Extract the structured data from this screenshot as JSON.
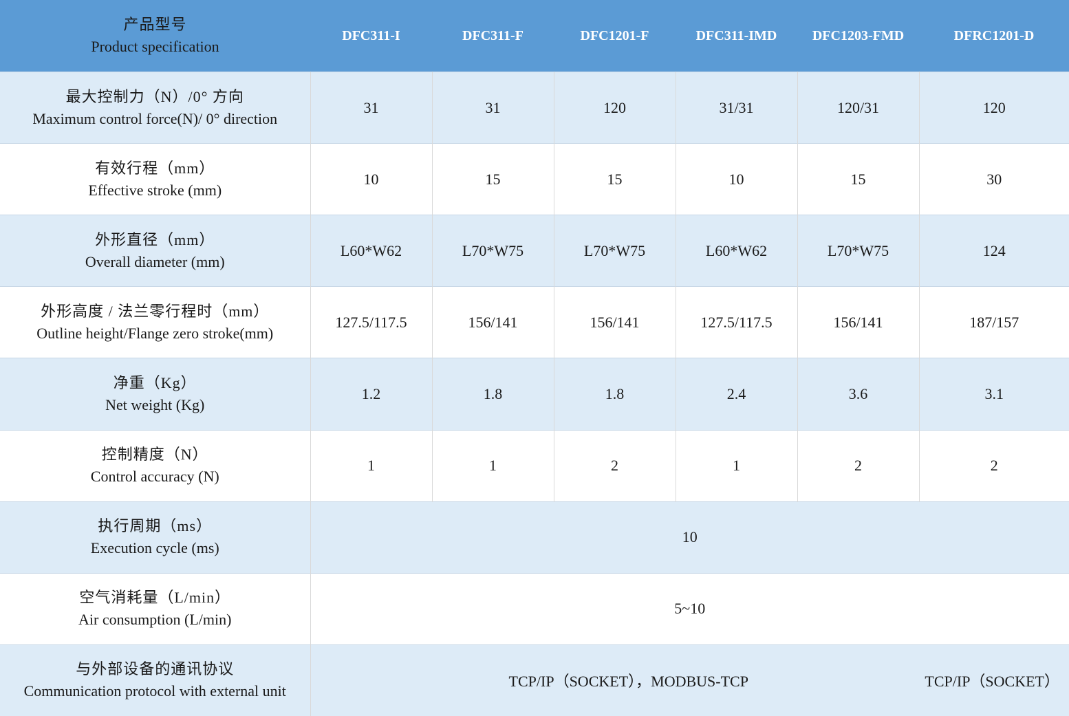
{
  "header": {
    "label_zh": "产品型号",
    "label_en": "Product specification",
    "models": [
      "DFC311-I",
      "DFC311-F",
      "DFC1201-F",
      "DFC311-IMD",
      "DFC1203-FMD",
      "DFRC1201-D"
    ]
  },
  "rows": [
    {
      "label_zh": "最大控制力（N）/0° 方向",
      "label_en": "Maximum control force(N)/ 0° direction",
      "values": [
        "31",
        "31",
        "120",
        "31/31",
        "120/31",
        "120"
      ]
    },
    {
      "label_zh": "有效行程（mm）",
      "label_en": "Effective stroke (mm)",
      "values": [
        "10",
        "15",
        "15",
        "10",
        "15",
        "30"
      ]
    },
    {
      "label_zh": "外形直径（mm）",
      "label_en": "Overall diameter (mm)",
      "values": [
        "L60*W62",
        "L70*W75",
        "L70*W75",
        "L60*W62",
        "L70*W75",
        "124"
      ]
    },
    {
      "label_zh": "外形高度 / 法兰零行程时（mm）",
      "label_en": "Outline height/Flange zero stroke(mm)",
      "values": [
        "127.5/117.5",
        "156/141",
        "156/141",
        "127.5/117.5",
        "156/141",
        "187/157"
      ]
    },
    {
      "label_zh": "净重（Kg）",
      "label_en": "Net weight (Kg)",
      "values": [
        "1.2",
        "1.8",
        "1.8",
        "2.4",
        "3.6",
        "3.1"
      ]
    },
    {
      "label_zh": "控制精度（N）",
      "label_en": "Control accuracy (N)",
      "values": [
        "1",
        "1",
        "2",
        "1",
        "2",
        "2"
      ]
    }
  ],
  "execution_cycle": {
    "label_zh": "执行周期（ms）",
    "label_en": "Execution cycle (ms)",
    "value": "10"
  },
  "air_consumption": {
    "label_zh": "空气消耗量（L/min）",
    "label_en": "Air consumption (L/min)",
    "value": "5~10"
  },
  "protocol": {
    "label_zh": "与外部设备的通讯协议",
    "label_en": "Communication protocol with external unit",
    "value_main": "TCP/IP（SOCKET），MODBUS-TCP",
    "value_last": "TCP/IP（SOCKET）"
  },
  "colors": {
    "header_bg": "#5b9bd5",
    "shaded_row_bg": "#ddebf7",
    "plain_row_bg": "#ffffff"
  }
}
